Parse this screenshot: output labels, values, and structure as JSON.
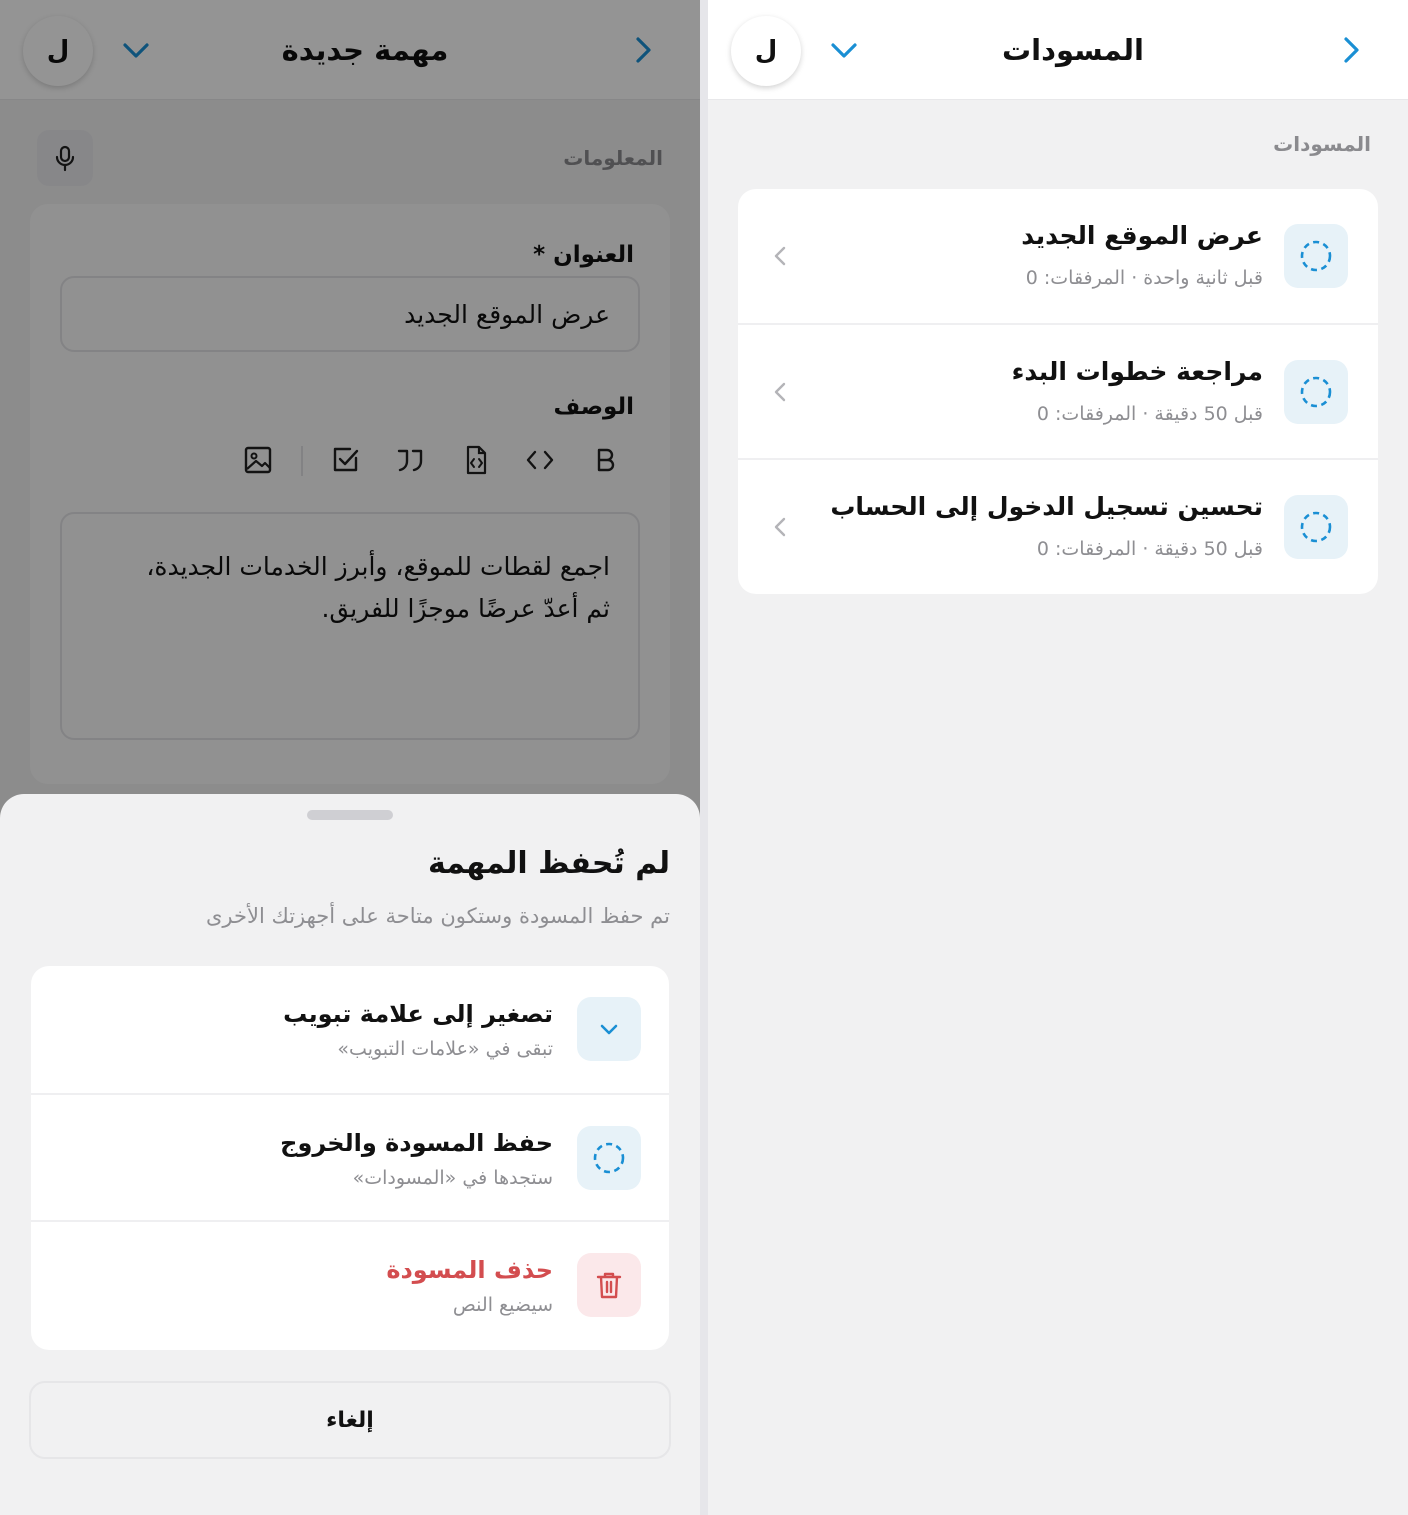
{
  "left_panel": {
    "header": {
      "title": "مهمة جديدة",
      "avatar_initial": "ل"
    },
    "form": {
      "section_label": "المعلومات",
      "title_label": "العنوان *",
      "title_value": "عرض الموقع الجديد",
      "description_label": "الوصف",
      "toolbar_icons": [
        "bold-icon",
        "code-icon",
        "code-file-icon",
        "quote-icon",
        "checkbox-icon",
        "image-icon"
      ],
      "description_value": "اجمع لقطات للموقع، وأبرز الخدمات الجديدة،\nثم أعدّ عرضًا موجزًا للفريق."
    },
    "sheet": {
      "title": "لم تُحفظ المهمة",
      "subtitle": "تم حفظ المسودة وستكون متاحة على أجهزتك الأخرى",
      "actions": [
        {
          "title": "تصغير إلى علامة تبويب",
          "subtitle": "تبقى في «علامات التبويب»",
          "icon": "chevron-down-icon"
        },
        {
          "title": "حفظ المسودة والخروج",
          "subtitle": "ستجدها في «المسودات»",
          "icon": "draft-icon"
        },
        {
          "title": "حذف المسودة",
          "subtitle": "سيضيع النص",
          "icon": "trash-icon"
        }
      ],
      "cancel_label": "إلغاء"
    }
  },
  "right_panel": {
    "header": {
      "title": "المسودات",
      "avatar_initial": "ل"
    },
    "section_label": "المسودات",
    "drafts": [
      {
        "title": "عرض الموقع الجديد",
        "meta": "قبل ثانية واحدة · المرفقات: 0"
      },
      {
        "title": "مراجعة خطوات البدء",
        "meta": "قبل 50 دقيقة · المرفقات: 0"
      },
      {
        "title": "تحسين تسجيل الدخول إلى الحساب",
        "meta": "قبل 50 دقيقة · المرفقات: 0"
      }
    ]
  },
  "colors": {
    "accent": "#1a8fd4",
    "danger": "#d34d4f",
    "icon_bg": "#e7f2f8",
    "danger_bg": "#fbe8ea"
  }
}
